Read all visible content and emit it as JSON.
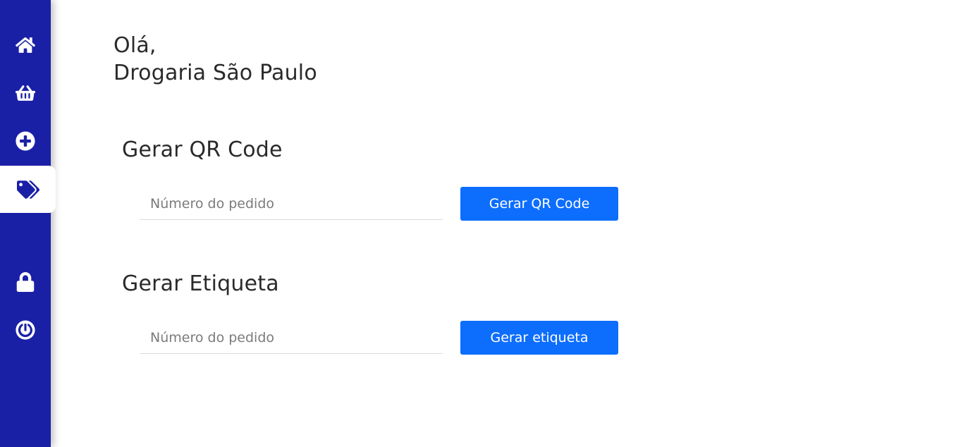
{
  "sidebar": {
    "items": [
      {
        "icon": "home-icon"
      },
      {
        "icon": "basket-icon"
      },
      {
        "icon": "plus-circle-icon"
      },
      {
        "icon": "tags-icon",
        "active": true
      },
      {
        "icon": "lock-icon"
      },
      {
        "icon": "power-icon"
      }
    ],
    "color": "#1a20a6"
  },
  "greeting": {
    "line1": "Olá,",
    "line2": "Drogaria São Paulo"
  },
  "qrcode_section": {
    "title": "Gerar QR Code",
    "input_placeholder": "Número do pedido",
    "input_value": "",
    "button_label": "Gerar QR Code"
  },
  "label_section": {
    "title": "Gerar Etiqueta",
    "input_placeholder": "Número do pedido",
    "input_value": "",
    "button_label": "Gerar etiqueta"
  },
  "colors": {
    "accent": "#0d6efd",
    "sidebar": "#1a20a6"
  }
}
